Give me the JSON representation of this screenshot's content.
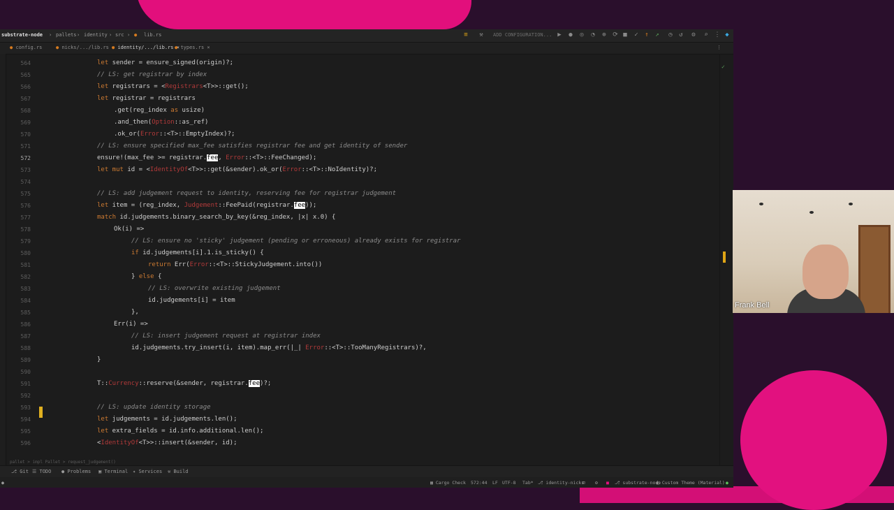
{
  "breadcrumbs": [
    "substrate-node",
    "pallets",
    "identity",
    "src",
    "lib.rs"
  ],
  "toolbar": {
    "config_label": "ADD CONFIGURATION..."
  },
  "tabs": [
    {
      "label": "config.rs",
      "active": false
    },
    {
      "label": "nicks/.../lib.rs",
      "active": false
    },
    {
      "label": "identity/.../lib.rs",
      "active": true
    },
    {
      "label": "types.rs",
      "active": false
    }
  ],
  "line_numbers": [
    "564",
    "565",
    "566",
    "567",
    "568",
    "569",
    "570",
    "571",
    "572",
    "573",
    "574",
    "575",
    "576",
    "577",
    "578",
    "579",
    "580",
    "581",
    "582",
    "583",
    "584",
    "585",
    "586",
    "587",
    "588",
    "589",
    "590",
    "591",
    "592",
    "593",
    "594",
    "595",
    "596"
  ],
  "current_line": "572",
  "code": {
    "l1_kw": "let",
    "l1_rest": " sender = ensure_signed(origin)?;",
    "l2": "// LS: get registrar by index",
    "l3_kw": "let",
    "l3_a": " registrars = <",
    "l3_ty": "Registrars",
    "l3_b": "<T>>::get();",
    "l4_kw": "let",
    "l4_rest": " registrar = registrars",
    "l5_a": ".get(reg_index ",
    "l5_kw": "as",
    "l5_b": " usize)",
    "l6_a": ".and_then(",
    "l6_ty": "Option",
    "l6_b": "::as_ref)",
    "l7_a": ".ok_or(",
    "l7_ty": "Error",
    "l7_b": "::<T>::EmptyIndex)?;",
    "l8": "// LS: ensure specified max_fee satisfies registrar fee and get identity of sender",
    "l9_a": "ensure!(max_fee >= registrar.",
    "l9_hl": "fee",
    "l9_b": ", ",
    "l9_ty": "Error",
    "l9_c": "::<T>::FeeChanged);",
    "l10_kw": "let mut",
    "l10_a": " id = <",
    "l10_ty": "IdentityOf",
    "l10_b": "<T>>::get(&sender).ok_or(",
    "l10_ty2": "Error",
    "l10_c": "::<T>::NoIdentity)?;",
    "l12": "// LS: add judgement request to identity, reserving fee for registrar judgement",
    "l13_kw": "let",
    "l13_a": " item = (reg_index, ",
    "l13_ty": "Judgement",
    "l13_b": "::FeePaid(registrar.",
    "l13_hl": "fee",
    "l13_c": "));",
    "l14_kw": "match",
    "l14_rest": " id.judgements.binary_search_by_key(&reg_index, |x| x.0) {",
    "l15": "Ok(i) =>",
    "l16": "// LS: ensure no 'sticky' judgement (pending or erroneous) already exists for registrar",
    "l17_kw": "if",
    "l17_rest": " id.judgements[i].1.is_sticky() {",
    "l18_kw": "return",
    "l18_a": " Err(",
    "l18_ty": "Error",
    "l18_b": "::<T>::StickyJudgement.into())",
    "l19_a": "} ",
    "l19_kw": "else",
    "l19_b": " {",
    "l20": "// LS: overwrite existing judgement",
    "l21": "id.judgements[i] = item",
    "l22": "},",
    "l23": "Err(i) =>",
    "l24": "// LS: insert judgement request at registrar index",
    "l25_a": "id.judgements.try_insert(i, item).map_err(|_| ",
    "l25_ty": "Error",
    "l25_b": "::<T>::TooManyRegistrars)?,",
    "l26": "}",
    "l28_a": "T::",
    "l28_ty": "Currency",
    "l28_b": "::reserve(&sender, registrar.",
    "l28_hl": "fee",
    "l28_c": ")?;",
    "l30": "// LS: update identity storage",
    "l31_kw": "let",
    "l31_rest": " judgements = id.judgements.len();",
    "l32_kw": "let",
    "l32_rest": " extra_fields = id.info.additional.len();",
    "l33_a": "<",
    "l33_ty": "IdentityOf",
    "l33_b": "<T>>::insert(&sender, id);"
  },
  "code_breadcrumb": "pallet  >  impl Pallet  >  request_judgement()",
  "tool_windows": [
    "Git",
    "TODO",
    "Problems",
    "Terminal",
    "Services",
    "Build"
  ],
  "status": {
    "cargo": "Cargo Check",
    "position": "572:44",
    "line_sep": "LF",
    "encoding": "UTF-8",
    "indent": "Tab*",
    "branch1": "identity-nicks",
    "project": "substrate-node",
    "theme": "Custom Theme (Material)"
  },
  "participant": {
    "name": "Frank Bell"
  },
  "colors": {
    "accent_pink": "#e20f7c",
    "background": "#2a0f2c",
    "editor_bg": "#1c1c1c"
  }
}
